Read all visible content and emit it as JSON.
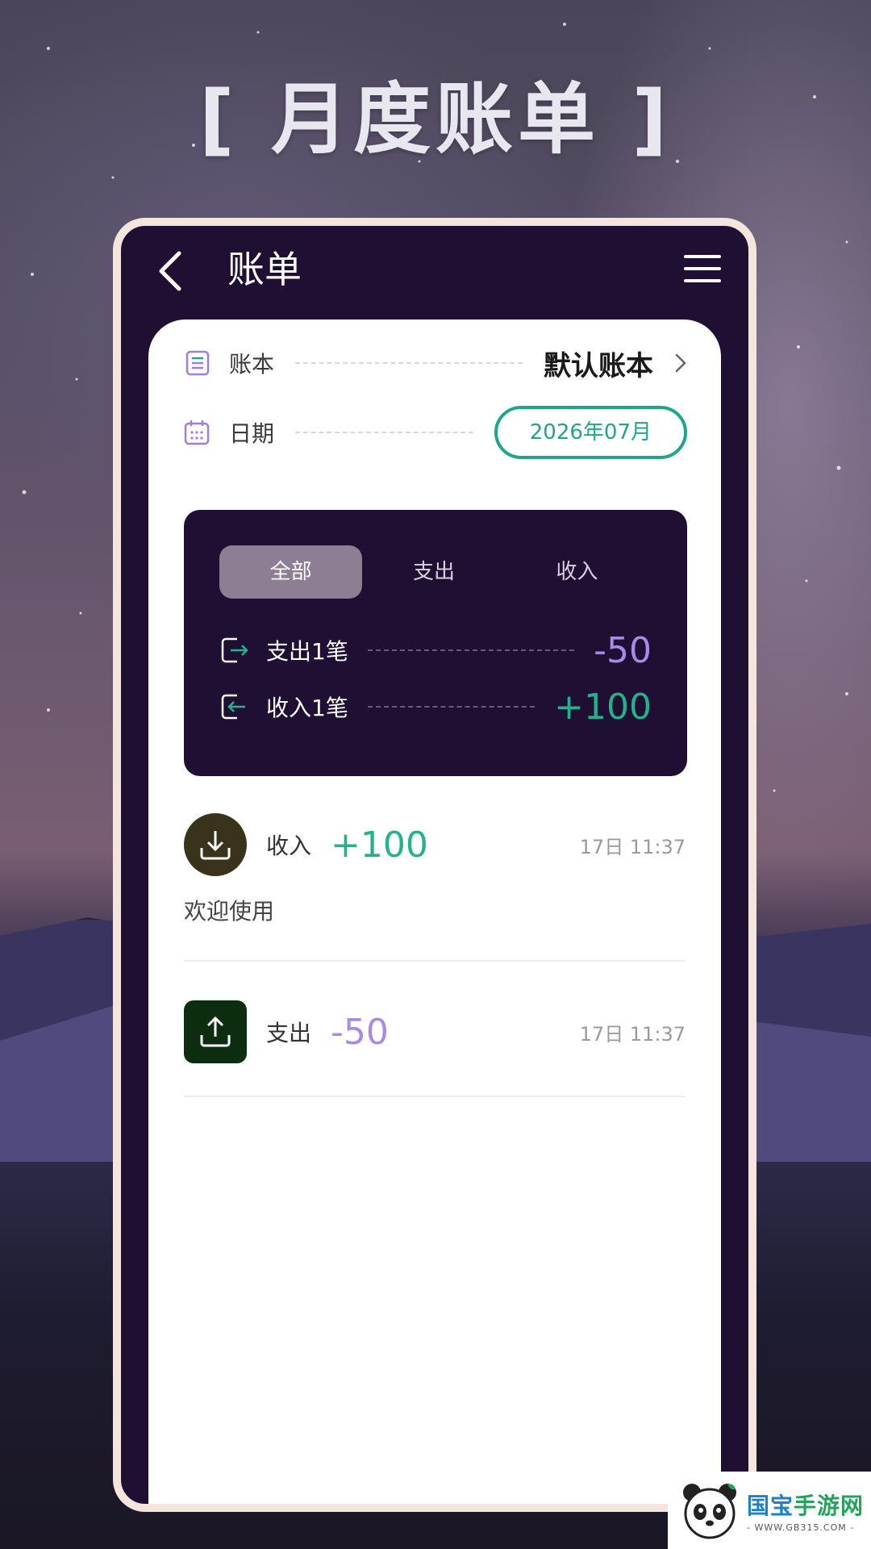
{
  "headline": "[ 月度账单 ]",
  "topbar": {
    "title": "账单",
    "back_icon": "chevron-left-icon",
    "menu_icon": "hamburger-menu-icon"
  },
  "ledger": {
    "label": "账本",
    "value": "默认账本",
    "icon": "list-icon"
  },
  "date": {
    "label": "日期",
    "value": "2026年07月",
    "icon": "calendar-icon"
  },
  "tabs": [
    "全部",
    "支出",
    "收入"
  ],
  "active_tab": "全部",
  "summary": {
    "expense": {
      "label": "支出1笔",
      "value": "-50"
    },
    "income": {
      "label": "收入1笔",
      "value": "+100"
    }
  },
  "transactions": [
    {
      "type": "收入",
      "amount": "+100",
      "time": "17日 11:37",
      "note": "欢迎使用",
      "icon": "download-icon"
    },
    {
      "type": "支出",
      "amount": "-50",
      "time": "17日 11:37",
      "note": "",
      "icon": "upload-icon"
    }
  ],
  "watermark": {
    "brand_part1": "国宝",
    "brand_part2": "手游网",
    "url": "- WWW.GB315.COM -"
  },
  "colors": {
    "phone_bg": "#1f0f33",
    "income": "#22b38e",
    "expense": "#a98ae6",
    "pill_border": "#1fa68a",
    "active_tab": "#8d7e94"
  }
}
